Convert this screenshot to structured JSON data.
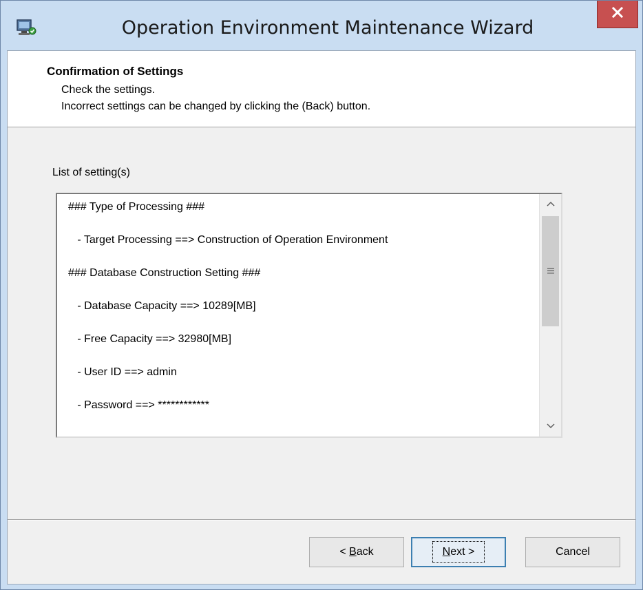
{
  "window": {
    "title": "Operation Environment Maintenance Wizard",
    "close_label": "x"
  },
  "header": {
    "title": "Confirmation of Settings",
    "line1": "Check the settings.",
    "line2": "Incorrect settings can be changed by clicking the (Back) button."
  },
  "list": {
    "label": "List of setting(s)",
    "items": [
      "### Type of Processing ###",
      "   - Target Processing ==> Construction of Operation Environment",
      "### Database Construction Setting ###",
      "   - Database Capacity ==> 10289[MB]",
      "   - Free Capacity ==> 32980[MB]",
      "   - User ID ==> admin",
      "   - Password ==> ************"
    ]
  },
  "buttons": {
    "back_prefix": "< ",
    "back_accel": "B",
    "back_rest": "ack",
    "next_accel": "N",
    "next_rest": "ext >",
    "cancel": "Cancel"
  },
  "colors": {
    "titlebar": "#c9ddf2",
    "close_button": "#c75050",
    "dialog_bg": "#f0f0f0",
    "default_button_border": "#3c7fb1"
  },
  "icons": {
    "app": "wizard-computer-icon",
    "close": "close-icon",
    "scroll_up": "chevron-up-icon",
    "scroll_down": "chevron-down-icon",
    "thumb_grip": "grip-icon"
  }
}
